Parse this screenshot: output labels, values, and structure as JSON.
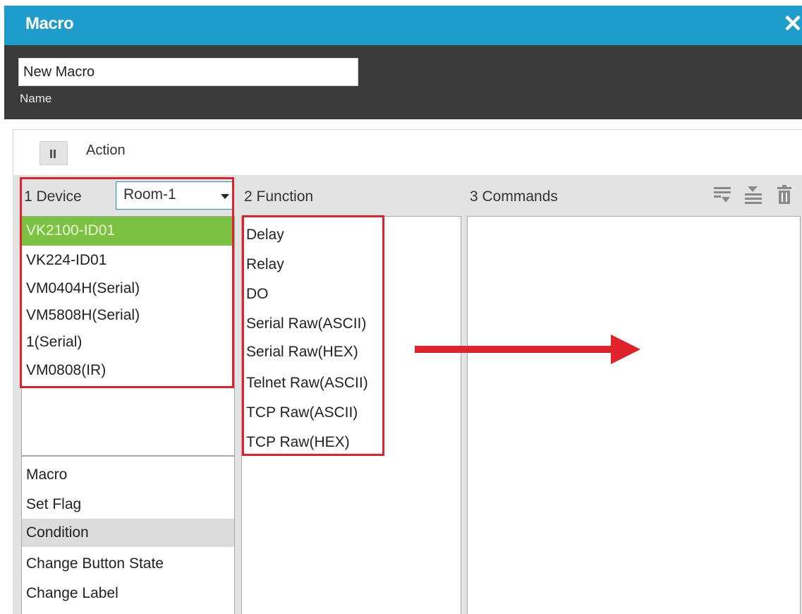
{
  "window": {
    "title": "Macro",
    "close_glyph": "✕"
  },
  "name": {
    "value": "New Macro",
    "label": "Name"
  },
  "action": {
    "label": "Action"
  },
  "columns": {
    "device": {
      "header": "1  Device",
      "room_selected": "Room-1"
    },
    "function": {
      "header": "2  Function"
    },
    "commands": {
      "header": "3  Commands"
    }
  },
  "toolbar_icons": [
    "insert-below-icon",
    "import-icon",
    "delete-icon"
  ],
  "devices": [
    "VK2100-ID01",
    "VK224-ID01",
    "VM0404H(Serial)",
    "VM5808H(Serial)",
    "1(Serial)",
    "VM0808(IR)"
  ],
  "selected_device_index": 0,
  "actions": [
    "Macro",
    "Set Flag",
    "Condition",
    "Change Button State",
    "Change Label"
  ],
  "highlighted_action_index": 2,
  "functions": [
    "Delay",
    "Relay",
    "DO",
    "Serial Raw(ASCII)",
    "Serial Raw(HEX)",
    "Telnet Raw(ASCII)",
    "TCP Raw(ASCII)",
    "TCP Raw(HEX)"
  ],
  "colors": {
    "titlebar": "#1e9ccc",
    "selection": "#7cc242",
    "annotation": "#e0232b"
  }
}
